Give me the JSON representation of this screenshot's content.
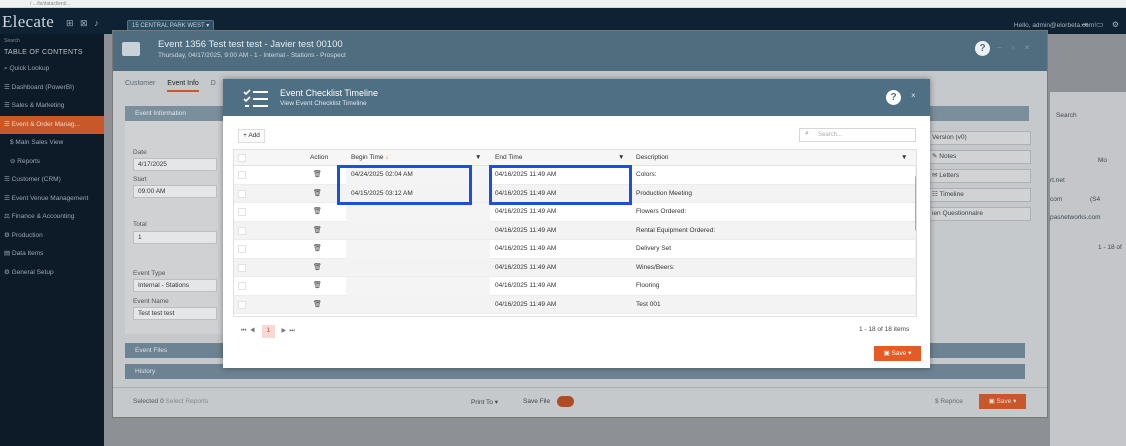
{
  "browser": {
    "url": "/ .../ts/dataclient/..."
  },
  "topbar": {
    "logo": "Elecate",
    "icons": "⊞ ⊠ ♪",
    "venue": "15 CENTRAL PARK WEST",
    "greeting": "Hello, admin@elorbeta.com!",
    "right_icons": "⇥ ▭ ⚙"
  },
  "sidebar": {
    "search_label": "Search",
    "toc": "TABLE OF CONTENTS",
    "items": [
      {
        "label": "Quick Lookup"
      },
      {
        "label": "Dashboard (PowerBI)"
      },
      {
        "label": "Sales & Marketing"
      },
      {
        "label": "Event & Order Manag..."
      },
      {
        "label": "Main Sales View"
      },
      {
        "label": "Reports"
      },
      {
        "label": "Customer (CRM)"
      },
      {
        "label": "Event Venue Management"
      },
      {
        "label": "Finance & Accounting"
      },
      {
        "label": "Production"
      },
      {
        "label": "Data Items"
      },
      {
        "label": "General Setup"
      }
    ]
  },
  "background_right": {
    "search": "Search",
    "net": "rt.net",
    "com": "com",
    "s4": "(S4",
    "email": "pasnetworks.com",
    "pager": "1 - 18 of",
    "filter": "Mo"
  },
  "event_window": {
    "title": "Event 1356 Test test test - Javier test 00100",
    "subtitle": "Thursday, 04/17/2025, 9:00 AM - 1 - Internal - Stations - Prospect",
    "tabs": [
      "Customer",
      "Event Info",
      "D"
    ],
    "section_header": "Event Information",
    "date_label": "Date",
    "date_value": "4/17/2025",
    "start_label": "Start",
    "start_value": "09:00 AM",
    "total_label": "Total",
    "total_value": "1",
    "event_type_label": "Event Type",
    "event_type_value": "Internal - Stations",
    "event_name_label": "Event Name",
    "event_name_value": "Test test test",
    "right_buttons": [
      "Version (v0)",
      "Notes",
      "Letters",
      "Timeline",
      "ien Questionnaire"
    ],
    "event_files": "Event Files",
    "history": "History",
    "selected_label": "Selected",
    "selected_count": "0",
    "select_reports": "Select Reports",
    "print_to": "Print To",
    "save_file": "Save File",
    "reprice": "Reprice",
    "save": "Save"
  },
  "dialog": {
    "title": "Event Checklist Timeline",
    "subtitle": "View Event Checklist Timeline",
    "add_label": "+ Add",
    "search_placeholder": "Search...",
    "columns": {
      "action": "Action",
      "begin_time": "Begin Time",
      "end_time": "End Time",
      "description": "Description"
    },
    "rows": [
      {
        "begin": "04/24/2025 02:04 AM",
        "end": "04/16/2025 11:49 AM",
        "desc": "Colors:"
      },
      {
        "begin": "04/15/2025 03:12 AM",
        "end": "04/16/2025 11:49 AM",
        "desc": "Production Meeting"
      },
      {
        "begin": "",
        "end": "04/16/2025 11:49 AM",
        "desc": "Flowers Ordered:"
      },
      {
        "begin": "",
        "end": "04/16/2025 11:49 AM",
        "desc": "Rental Equipment Ordered:"
      },
      {
        "begin": "",
        "end": "04/16/2025 11:49 AM",
        "desc": "Delivery Set"
      },
      {
        "begin": "",
        "end": "04/16/2025 11:49 AM",
        "desc": "Wines/Beers:"
      },
      {
        "begin": "",
        "end": "04/16/2025 11:49 AM",
        "desc": "Flooring"
      },
      {
        "begin": "",
        "end": "04/16/2025 11:49 AM",
        "desc": "Test 001"
      }
    ],
    "pager": {
      "first": "⏮",
      "prev": "◀",
      "current": "1",
      "next": "▶",
      "last": "⏭"
    },
    "items_text": "1 - 18 of 18 items",
    "save": "Save"
  },
  "colors": {
    "accent": "#e45b28",
    "header": "#4f6f84",
    "highlight": "#1d4fd8"
  }
}
